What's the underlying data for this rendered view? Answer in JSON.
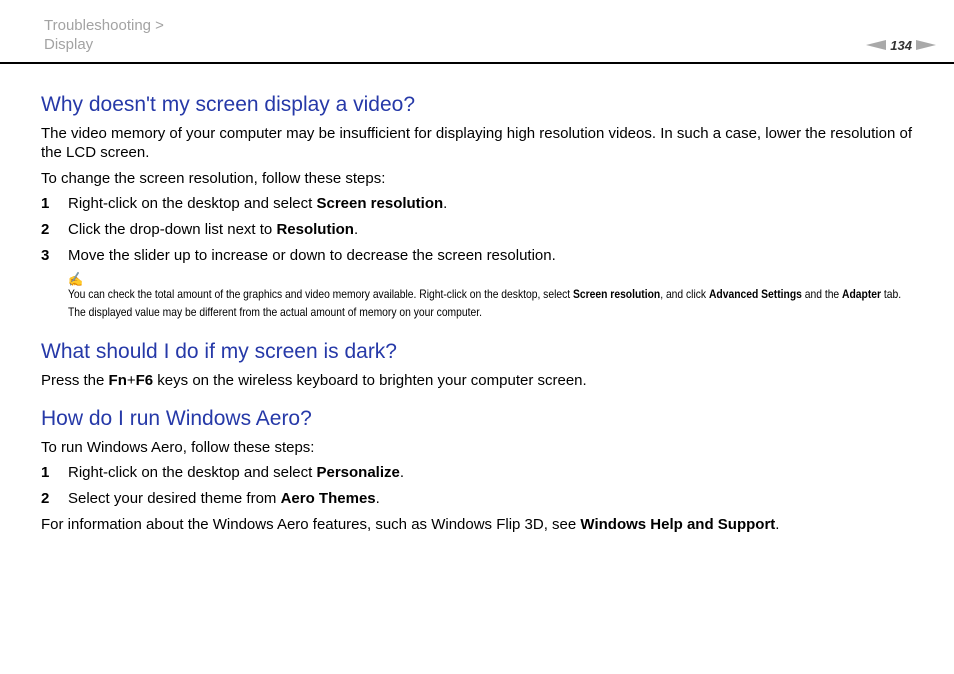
{
  "header": {
    "breadcrumb_line1": "Troubleshooting >",
    "breadcrumb_line2": "Display",
    "page_number": "134"
  },
  "section1": {
    "heading": "Why doesn't my screen display a video?",
    "para1": "The video memory of your computer may be insufficient for displaying high resolution videos. In such a case, lower the resolution of the LCD screen.",
    "para2": "To change the screen resolution, follow these steps:",
    "steps": [
      {
        "num": "1",
        "pre": "Right-click on the desktop and select ",
        "bold": "Screen resolution",
        "post": "."
      },
      {
        "num": "2",
        "pre": "Click the drop-down list next to ",
        "bold": "Resolution",
        "post": "."
      },
      {
        "num": "3",
        "pre": "Move the slider up to increase or down to decrease the screen resolution.",
        "bold": "",
        "post": ""
      }
    ],
    "note": {
      "icon": "note-pencil-icon",
      "t1": "You can check the total amount of the graphics and video memory available. Right-click on the desktop, select ",
      "b1": "Screen resolution",
      "t2": ", and click ",
      "b2": "Advanced Settings",
      "t3": " and the ",
      "b3": "Adapter",
      "t4": " tab. The displayed value may be different from the actual amount of memory on your computer."
    }
  },
  "section2": {
    "heading": "What should I do if my screen is dark?",
    "pre": "Press the ",
    "key1": "Fn",
    "plus": "+",
    "key2": "F6",
    "post": " keys on the wireless keyboard to brighten your computer screen."
  },
  "section3": {
    "heading": "How do I run Windows Aero?",
    "intro": "To run Windows Aero, follow these steps:",
    "steps": [
      {
        "num": "1",
        "pre": "Right-click on the desktop and select ",
        "bold": "Personalize",
        "post": "."
      },
      {
        "num": "2",
        "pre": "Select your desired theme from ",
        "bold": "Aero Themes",
        "post": "."
      }
    ],
    "info_pre": "For information about the Windows Aero features, such as Windows Flip 3D, see ",
    "info_bold": "Windows Help and Support",
    "info_post": "."
  },
  "colors": {
    "heading": "#2639a8",
    "breadcrumb": "#a3a3a3",
    "pager_arrows": "#a9a9a9"
  }
}
